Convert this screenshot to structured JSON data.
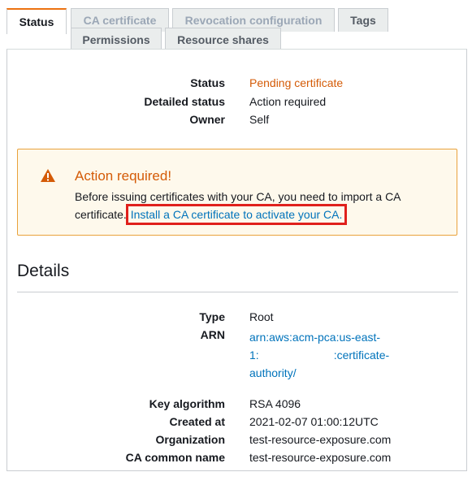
{
  "tabs": [
    {
      "label": "Status",
      "state": "active"
    },
    {
      "label": "CA certificate",
      "state": "disabled"
    },
    {
      "label": "Revocation configuration",
      "state": "disabled"
    },
    {
      "label": "Tags",
      "state": "normal"
    },
    {
      "label": "Permissions",
      "state": "normal"
    },
    {
      "label": "Resource shares",
      "state": "normal"
    }
  ],
  "status": {
    "status_label": "Status",
    "status_value": "Pending certificate",
    "detailed_label": "Detailed status",
    "detailed_value": "Action required",
    "owner_label": "Owner",
    "owner_value": "Self"
  },
  "alert": {
    "icon": "warning-icon",
    "title": "Action required!",
    "body_line1": "Before issuing certificates with your CA, you need to import a CA",
    "body_prefix": "certificate.",
    "link": "Install a CA certificate to activate your CA."
  },
  "details": {
    "heading": "Details",
    "type_label": "Type",
    "type_value": "Root",
    "arn_label": "ARN",
    "arn_line1": "arn:aws:acm-pca:us-east-",
    "arn_line2": "1:",
    "arn_line2b": ":certificate-",
    "arn_line3": "authority/",
    "key_label": "Key algorithm",
    "key_value": "RSA 4096",
    "created_label": "Created at",
    "created_value": "2021-02-07 01:00:12UTC",
    "org_label": "Organization",
    "org_value": "test-resource-exposure.com",
    "cn_label": "CA common name",
    "cn_value": "test-resource-exposure.com"
  },
  "colors": {
    "accent": "#ec7211",
    "warning_text": "#d45b07",
    "link": "#0073bb",
    "highlight_box": "#e0201c"
  }
}
